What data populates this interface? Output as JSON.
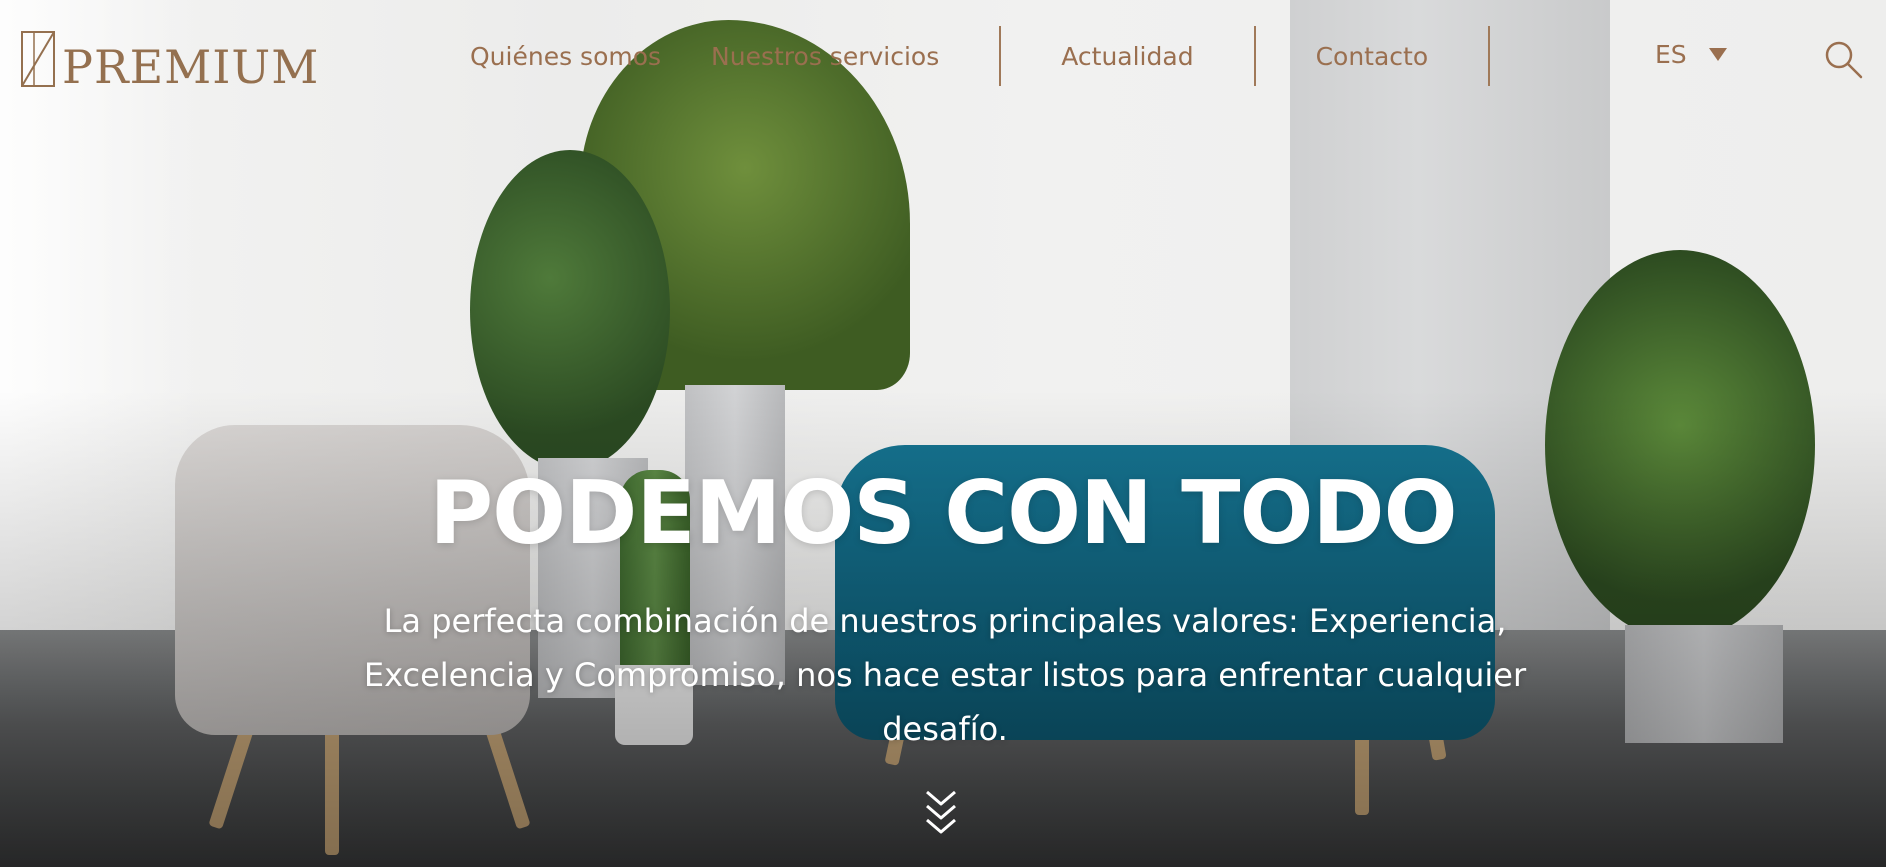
{
  "brand": {
    "logo_text": "PREMIUM",
    "logo_color": "#94704f"
  },
  "nav": {
    "items": [
      {
        "label": "Quiénes somos"
      },
      {
        "label": "Nuestros servicios"
      },
      {
        "label": "Actualidad"
      },
      {
        "label": "Contacto"
      }
    ],
    "text_color": "#9a6f4f"
  },
  "language": {
    "selected": "ES",
    "icon": "chevron-down-icon"
  },
  "search": {
    "icon": "search-icon"
  },
  "hero": {
    "title": "PODEMOS CON TODO",
    "subtitle": "La perfecta combinación de nuestros principales valores: Experiencia, Excelencia y Compromiso, nos hace estar listos para enfrentar cualquier desafío.",
    "scroll_icon": "double-chevron-down-icon",
    "text_color": "#ffffff",
    "accent_sofa": "#15728f"
  }
}
